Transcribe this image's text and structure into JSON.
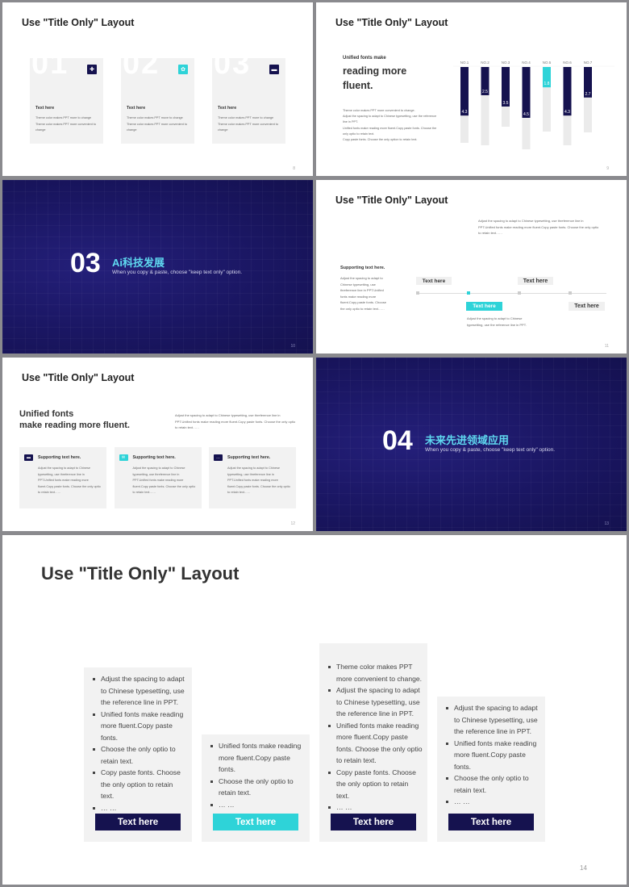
{
  "colors": {
    "navy": "#15124f",
    "cyan": "#2ed3d8",
    "card": "#f2f2f2",
    "dark_bg": "#1a1662"
  },
  "slide8": {
    "title": "Use \"Title Only\" Layout",
    "page": "8",
    "cards": [
      {
        "num": "01",
        "icon": "puzzle-icon",
        "icon_color": "navy",
        "heading": "Text here",
        "body": "Theme  color makes PPT more to change Theme  color makes PPT more convenient to change"
      },
      {
        "num": "02",
        "icon": "gear-icon",
        "icon_color": "cyan",
        "heading": "Text here",
        "body": "Theme  color makes PPT move to change Theme  color makes PPT more convenient to change"
      },
      {
        "num": "03",
        "icon": "briefcase-icon",
        "icon_color": "navy",
        "heading": "Text here",
        "body": "Theme  color makes PPT more to change Theme  color makes PPT more convenient to change"
      }
    ]
  },
  "slide9": {
    "title": "Use \"Title Only\" Layout",
    "page": "9",
    "kicker": "Unified fonts make",
    "headline": "reading more fluent.",
    "body": [
      "Theme color makes PPT more convenient to change.",
      "Adjust the spacing to adapt to Chinese typesetting, use the reference line in PPT.",
      "Unified fonts make reading more fluent.Copy paste fonts. Choose the only optio to retain text.",
      "Copy paste  fonts. Choose the only option to retain text."
    ]
  },
  "chart_data": {
    "type": "bar",
    "categories": [
      "NO.1",
      "NO.2",
      "NO.3",
      "NO.4",
      "NO.5",
      "NO.6",
      "NO.7"
    ],
    "values": [
      4.3,
      2.5,
      3.5,
      4.5,
      1.8,
      4.3,
      2.7
    ],
    "highlight": "NO.5",
    "orientation": "vertical-downward",
    "title": "",
    "xlabel": "",
    "ylabel": ""
  },
  "slide10": {
    "num": "03",
    "title": "Ai科技发展",
    "subtitle": "When you copy & paste, choose \"keep text only\" option.",
    "page": "10"
  },
  "slide11": {
    "title": "Use \"Title Only\" Layout",
    "page": "11",
    "top_text": "Adjust the spacing to adapt to Chinese typesetting, use threference line in PPT.Unified fonts make reading more fluent.Copy paste fonts. Choose the only optio to retain text……",
    "support_title": "Supporting text here.",
    "support_body": "Adjust the spacing to adapt to Chinese typesetting, use threference line in PPT.Unified fonts make reading more fluent.Copy paste fonts. Choose the only optio to retain text……",
    "labels": [
      "Text here",
      "Text here",
      "Text here",
      "Text here"
    ],
    "active_note": "Adjust the spacing to adapt to Chinese typesetting, use the reference line in PPT."
  },
  "slide12": {
    "title": "Use \"Title Only\" Layout",
    "page": "12",
    "headline1": "Unified fonts",
    "headline2": "make reading more fluent.",
    "side_text": "Adjust the spacing to adapt to Chinese typesetting, use threference line in PPT.Unified fonts make reading more fluent.Copy paste fonts. Choose the only optio to retain text……",
    "cards": [
      {
        "icon": "briefcase-icon",
        "heading": "Supporting text here.",
        "body": "Adjust the spacing to adapt to Chinese typesetting, use threference line in PPT.Unified fonts make reading more fluent.Copy paste fonts. Choose the only optio to retain text……"
      },
      {
        "icon": "mail-icon",
        "heading": "Supporting text here.",
        "body": "Adjust the spacing to adapt to Chinese typesetting, use threference line in PPT.Unified fonts make reading more fluent.Copy paste fonts. Choose the only optio to retain text……"
      },
      {
        "icon": "chat-icon",
        "heading": "Supporting text here.",
        "body": "Adjust the spacing to adapt to Chinese typesetting, use threference line in PPT.Unified fonts make reading more fluent.Copy paste fonts. Choose the only optio to retain text……"
      }
    ]
  },
  "slide13": {
    "num": "04",
    "title": "未来先进领域应用",
    "subtitle": "When you copy & paste, choose \"keep text only\" option.",
    "page": "13"
  },
  "slide14": {
    "title": "Use \"Title Only\" Layout",
    "page": "14",
    "columns": [
      {
        "items": [
          "Adjust the spacing to adapt to Chinese typesetting, use the reference line in PPT.",
          "Unified fonts make reading more fluent.Copy paste fonts.",
          "Choose the only optio to retain text.",
          "Copy paste  fonts. Choose the only option to retain text.",
          "… …"
        ],
        "button": "Text here",
        "button_color": "navy"
      },
      {
        "items": [
          "Unified fonts make reading more fluent.Copy paste fonts.",
          "Choose the only optio to retain text.",
          "… …"
        ],
        "button": "Text here",
        "button_color": "cyan"
      },
      {
        "items": [
          "Theme  color makes PPT more convenient to change.",
          "Adjust the spacing to adapt to Chinese typesetting, use the reference line in PPT.",
          "Unified fonts make reading more fluent.Copy paste fonts. Choose the only optio to retain text.",
          "Copy paste  fonts. Choose the only option to retain text.",
          "… …"
        ],
        "button": "Text here",
        "button_color": "navy"
      },
      {
        "items": [
          "Adjust the spacing to adapt to Chinese typesetting, use the reference line in PPT.",
          "Unified fonts make reading more fluent.Copy paste fonts.",
          "Choose the only optio to retain text.",
          "… …"
        ],
        "button": "Text here",
        "button_color": "navy"
      }
    ]
  }
}
